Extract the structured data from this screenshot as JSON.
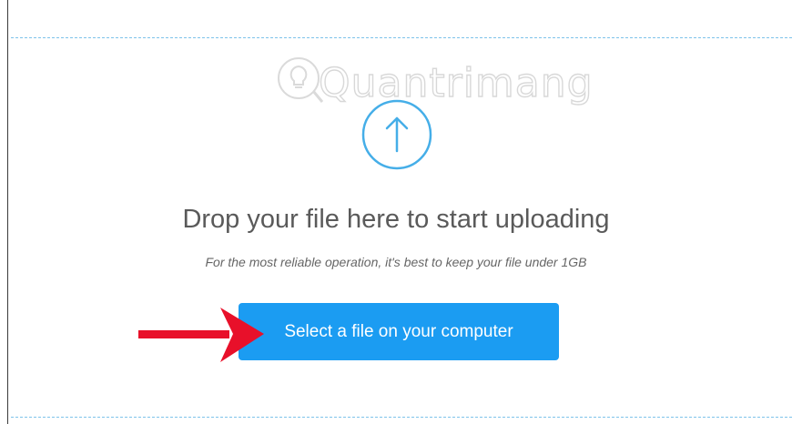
{
  "watermark": {
    "text": "Quantrimang",
    "icon": "lightbulb-icon"
  },
  "dropzone": {
    "icon": "arrow-up-circle-icon",
    "headline": "Drop your file here to start uploading",
    "note": "For the most reliable operation, it's best to keep your file under 1GB",
    "button_label": "Select a file on your computer"
  },
  "annotation": {
    "icon": "red-arrow-icon"
  },
  "colors": {
    "accent": "#1b9cf2",
    "dashed_border": "#7ec3ea",
    "annotation_arrow": "#e8102a",
    "headline_text": "#5a5a5a"
  }
}
